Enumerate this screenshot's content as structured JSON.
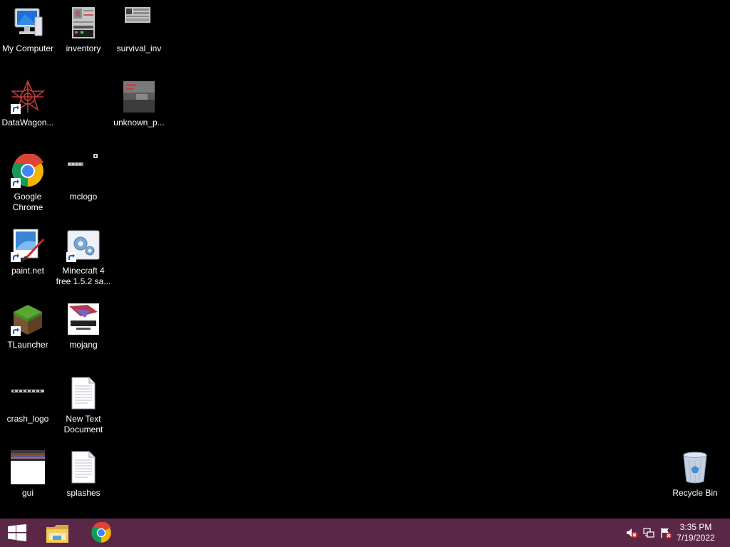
{
  "desktop": {
    "background_color": "#000000",
    "icons": [
      {
        "label": "My Computer",
        "icon": "computer-icon",
        "shortcut": false
      },
      {
        "label": "inventory",
        "icon": "image-thumbnail-icon",
        "shortcut": false
      },
      {
        "label": "survival_inv",
        "icon": "image-thumbnail-icon",
        "shortcut": false
      },
      {
        "label": "DataWagon...",
        "icon": "datawagon-icon",
        "shortcut": true
      },
      {
        "label": "unknown_p...",
        "icon": "image-thumbnail-icon",
        "shortcut": false
      },
      {
        "label": "Google\nChrome",
        "icon": "chrome-icon",
        "shortcut": true
      },
      {
        "label": "mclogo",
        "icon": "image-thumbnail-icon",
        "shortcut": false
      },
      {
        "label": "paint.net",
        "icon": "paintnet-icon",
        "shortcut": true
      },
      {
        "label": "Minecraft 4\nfree 1.5.2 sa...",
        "icon": "installer-gears-icon",
        "shortcut": true
      },
      {
        "label": "TLauncher",
        "icon": "grass-block-icon",
        "shortcut": true
      },
      {
        "label": "mojang",
        "icon": "image-thumbnail-icon",
        "shortcut": false
      },
      {
        "label": "crash_logo",
        "icon": "image-thumbnail-icon",
        "shortcut": false
      },
      {
        "label": "New Text\nDocument",
        "icon": "text-document-icon",
        "shortcut": false
      },
      {
        "label": "gui",
        "icon": "image-thumbnail-icon",
        "shortcut": false
      },
      {
        "label": "splashes",
        "icon": "text-document-icon",
        "shortcut": false
      },
      {
        "label": "Recycle Bin",
        "icon": "recycle-bin-icon",
        "shortcut": false
      }
    ]
  },
  "taskbar": {
    "color": "#5a2846",
    "pinned": [
      "windows-start-icon",
      "file-explorer-icon",
      "chrome-icon"
    ],
    "tray_icons": [
      "volume-muted-icon",
      "network-icon",
      "action-center-flag-icon"
    ],
    "clock": {
      "time": "3:35 PM",
      "date": "7/19/2022"
    }
  }
}
